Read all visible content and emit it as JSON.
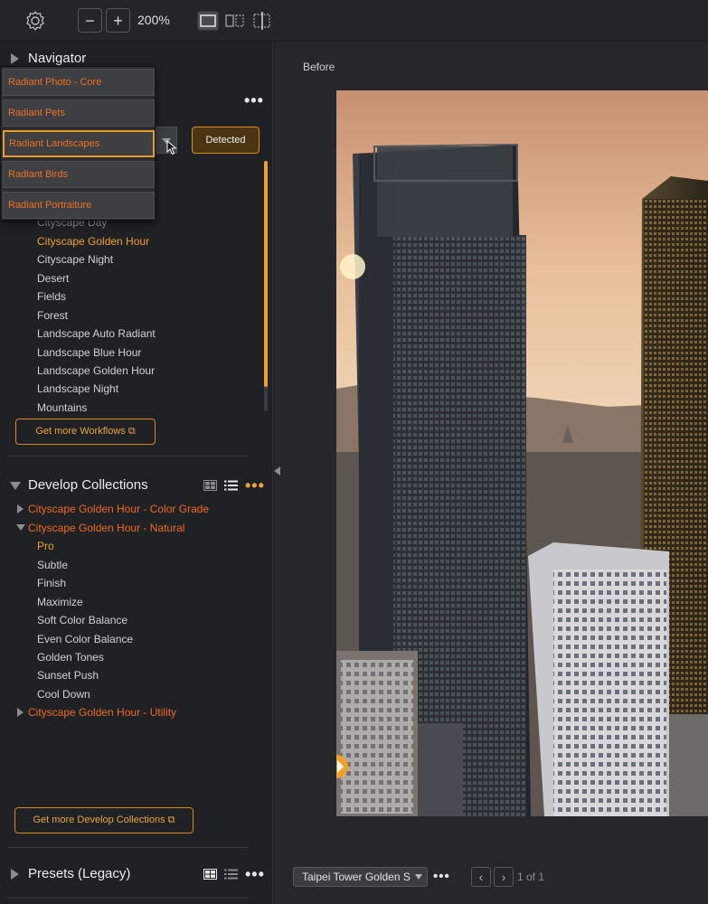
{
  "toolbar": {
    "zoom_out_label": "−",
    "zoom_in_label": "+",
    "zoom_level": "200%",
    "icons": {
      "settings": "gear-icon",
      "single_view": "single-view-icon",
      "split_view": "split-view-icon",
      "crop_view": "crop-compare-icon"
    }
  },
  "navigator": {
    "title": "Navigator",
    "more": "•••"
  },
  "workflow_dropdown": {
    "options": [
      "Radiant Photo - Core",
      "Radiant Pets",
      "Radiant Landscapes",
      "Radiant Birds",
      "Radiant Portraiture"
    ],
    "selected": "Radiant Landscapes",
    "detected_label": "Detected"
  },
  "workflows": {
    "items": [
      "Cityscape Day",
      "Cityscape Golden Hour",
      "Cityscape Night",
      "Desert",
      "Fields",
      "Forest",
      "Landscape Auto Radiant",
      "Landscape Blue Hour",
      "Landscape Golden Hour",
      "Landscape Night",
      "Mountains"
    ],
    "active": "Cityscape Golden Hour",
    "get_more_label": "Get more Workflows ⧉"
  },
  "develop_collections": {
    "title": "Develop Collections",
    "more": "•••",
    "groups": [
      {
        "name": "Cityscape Golden Hour - Color Grade",
        "expanded": false
      },
      {
        "name": "Cityscape Golden Hour - Natural",
        "expanded": true
      },
      {
        "name": "Cityscape Golden Hour - Utility",
        "expanded": false
      }
    ],
    "natural_items": [
      "Pro",
      "Subtle",
      "Finish",
      "Maximize",
      "Soft Color Balance",
      "Even Color Balance",
      "Golden Tones",
      "Sunset Push",
      "Cool Down"
    ],
    "active_item": "Pro",
    "get_more_label": "Get more Develop Collections ⧉"
  },
  "presets": {
    "title": "Presets (Legacy)",
    "more": "•••"
  },
  "preview": {
    "before_label": "Before",
    "file_name": "Taipei Tower Golden S",
    "more": "•••",
    "prev_label": "‹",
    "next_label": "›",
    "page_count": "1 of 1"
  },
  "colors": {
    "accent_orange": "#f0a12a",
    "collection_orange": "#f06a1e",
    "panel_bg": "#1f2125"
  }
}
